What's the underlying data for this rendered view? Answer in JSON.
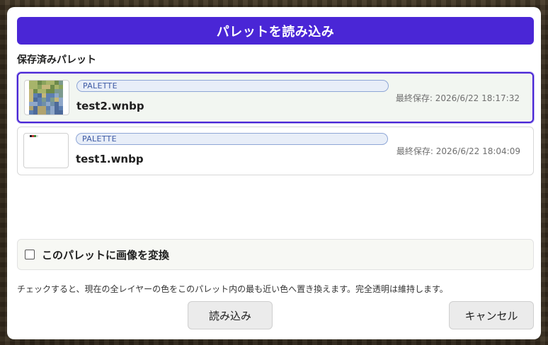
{
  "colors": {
    "accent": "#4a26d6",
    "selected_bg": "#f2f6f1",
    "tag_bg": "#e8eef8",
    "tag_text": "#3d5aa4"
  },
  "dialog": {
    "title": "パレットを読み込み",
    "section_label": "保存済みパレット",
    "palettes": [
      {
        "tag": "PALETTE",
        "name": "test2.wnbp",
        "saved_at": "最終保存: 2026/6/22 18:17:32",
        "selected": true,
        "thumbnail": "pixel-image-thumbnail"
      },
      {
        "tag": "PALETTE",
        "name": "test1.wnbp",
        "saved_at": "最終保存: 2026/6/22 18:04:09",
        "selected": false,
        "thumbnail": "small-swatch-thumbnail"
      }
    ],
    "convert_option": {
      "label": "このパレットに画像を変換",
      "checked": false
    },
    "hint": "チェックすると、現在の全レイヤーの色をこのパレット内の最も近い色へ置き換えます。完全透明は維持します。",
    "buttons": {
      "load": "読み込み",
      "cancel": "キャンセル"
    }
  }
}
